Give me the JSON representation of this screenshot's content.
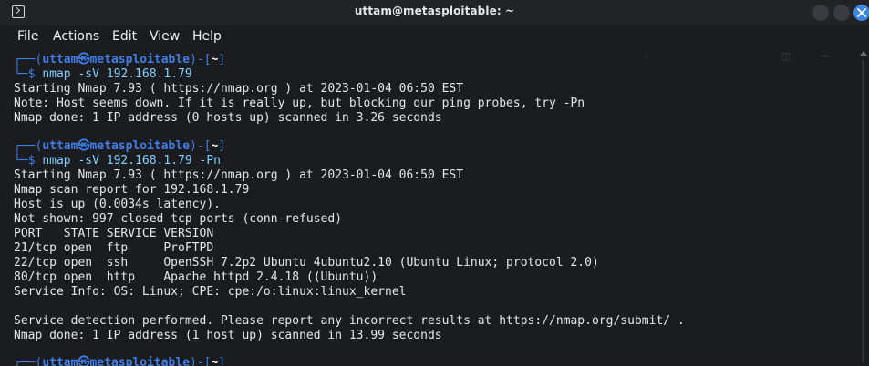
{
  "window": {
    "title": "uttam@metasploitable: ~"
  },
  "menu": {
    "items": [
      "File",
      "Actions",
      "Edit",
      "View",
      "Help"
    ]
  },
  "terminal": {
    "blocks": [
      {
        "prompt": {
          "user": "uttam",
          "at": "㉿",
          "host": "metasploitable",
          "dir": "~"
        },
        "command": "nmap -sV 192.168.1.79",
        "output": [
          "Starting Nmap 7.93 ( https://nmap.org ) at 2023-01-04 06:50 EST",
          "Note: Host seems down. If it is really up, but blocking our ping probes, try -Pn",
          "Nmap done: 1 IP address (0 hosts up) scanned in 3.26 seconds"
        ]
      },
      {
        "prompt": {
          "user": "uttam",
          "at": "㉿",
          "host": "metasploitable",
          "dir": "~"
        },
        "command": "nmap -sV 192.168.1.79 -Pn",
        "output": [
          "Starting Nmap 7.93 ( https://nmap.org ) at 2023-01-04 06:50 EST",
          "Nmap scan report for 192.168.1.79",
          "Host is up (0.0034s latency).",
          "Not shown: 997 closed tcp ports (conn-refused)",
          "PORT   STATE SERVICE VERSION",
          "21/tcp open  ftp     ProFTPD",
          "22/tcp open  ssh     OpenSSH 7.2p2 Ubuntu 4ubuntu2.10 (Ubuntu Linux; protocol 2.0)",
          "80/tcp open  http    Apache httpd 2.4.18 ((Ubuntu))",
          "Service Info: OS: Linux; CPE: cpe:/o:linux:linux_kernel",
          "",
          "Service detection performed. Please report any incorrect results at https://nmap.org/submit/ .",
          "Nmap done: 1 IP address (1 host up) scanned in 13.99 seconds"
        ]
      },
      {
        "prompt": {
          "user": "uttam",
          "at": "㉿",
          "host": "metasploitable",
          "dir": "~"
        }
      }
    ]
  },
  "colors": {
    "prompt_blue": "#3f7ee8",
    "command_cyan": "#7fd0ff",
    "close_button": "#3a86e0",
    "background": "#1b1c20"
  }
}
